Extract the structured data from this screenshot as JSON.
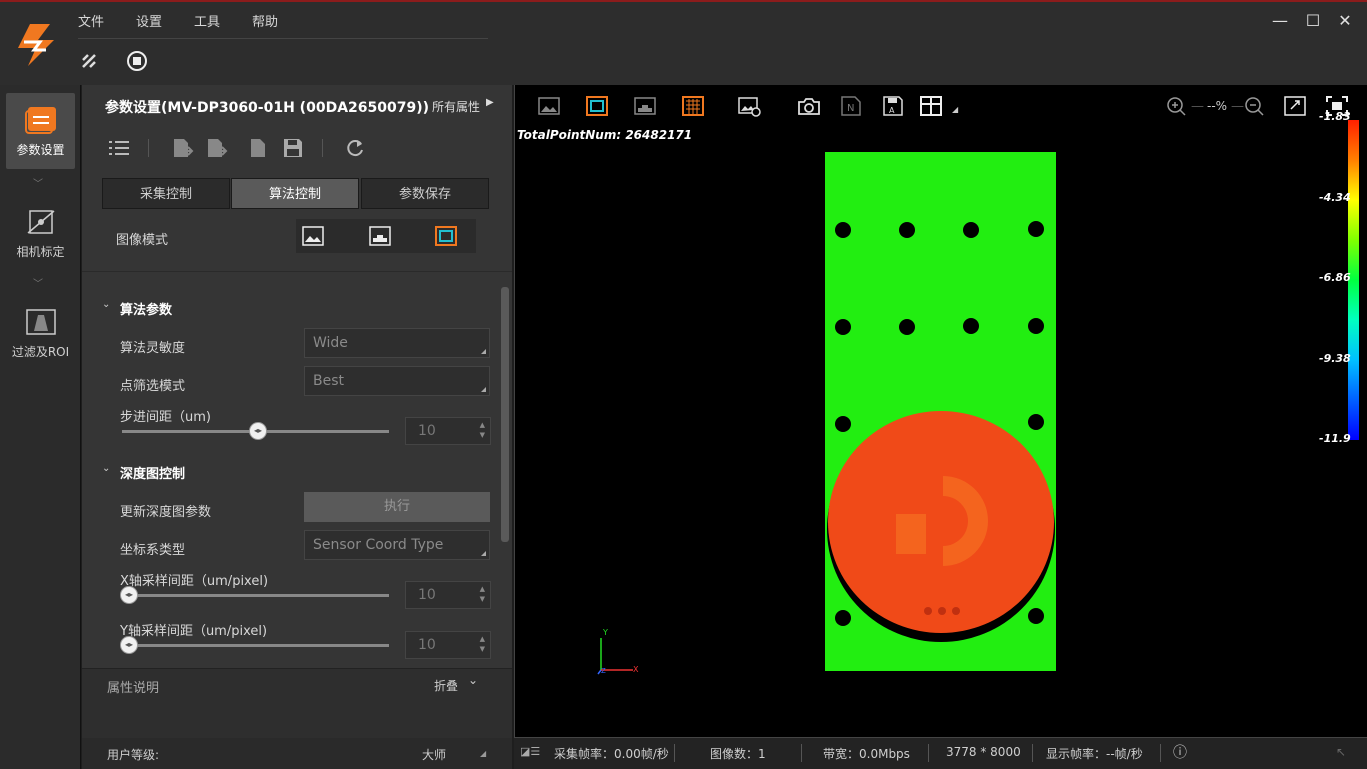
{
  "menu": {
    "file": "文件",
    "settings": "设置",
    "tools": "工具",
    "help": "帮助"
  },
  "sidebar": {
    "items": [
      {
        "label": "参数设置"
      },
      {
        "label": "相机标定"
      },
      {
        "label": "过滤及ROI"
      }
    ]
  },
  "panel": {
    "title": "参数设置(MV-DP3060-01H (00DA2650079))",
    "all_props": "所有属性",
    "tabs": [
      {
        "label": "采集控制"
      },
      {
        "label": "算法控制"
      },
      {
        "label": "参数保存"
      }
    ],
    "image_mode_label": "图像模式",
    "algo_section": "算法参数",
    "algo_sensitivity": {
      "label": "算法灵敏度",
      "value": "Wide"
    },
    "point_filter": {
      "label": "点筛选模式",
      "value": "Best"
    },
    "step": {
      "label": "步进间距（um)",
      "value": "10",
      "slider_fraction": 0.35
    },
    "depth_section": "深度图控制",
    "update_depth": {
      "label": "更新深度图参数",
      "button": "执行"
    },
    "coord_type": {
      "label": "坐标系类型",
      "value": "Sensor Coord Type"
    },
    "x_sample": {
      "label": "X轴采样间距（um/pixel)",
      "value": "10",
      "slider_fraction": 0.0
    },
    "y_sample": {
      "label": "Y轴采样间距（um/pixel)",
      "value": "10",
      "slider_fraction": 0.0
    },
    "prop_desc": {
      "label": "属性说明",
      "fold": "折叠"
    },
    "user_level": {
      "label": "用户等级:",
      "value": "大师"
    }
  },
  "viewer": {
    "total_points": "TotalPointNum: 26482171",
    "zoom": "--%",
    "colorbar": [
      "-1.83",
      "-4.34",
      "-6.86",
      "-9.38",
      "-11.9"
    ],
    "axis": {
      "x": "X",
      "y": "Y",
      "z": "Z"
    }
  },
  "status": {
    "fps": "采集帧率：0.00帧/秒",
    "images": "图像数：1",
    "bandwidth": "带宽：0.0Mbps",
    "resolution": "3778 * 8000",
    "display_fps": "显示帧率：--帧/秒"
  },
  "colors": {
    "accent": "#f07820",
    "green": "#22ee11",
    "red": "#f04a18",
    "title_border": "#8c1c1c"
  }
}
